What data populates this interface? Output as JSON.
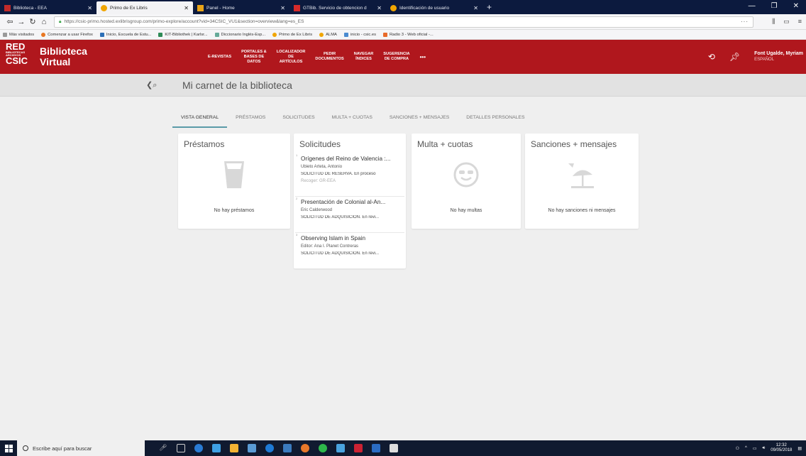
{
  "browser": {
    "tabs": [
      {
        "label": "Biblioteca - EEA",
        "active": false
      },
      {
        "label": "Primo de Ex Libris",
        "active": true
      },
      {
        "label": "Panel - Home",
        "active": false
      },
      {
        "label": "GTBib. Servicio de obtencion d",
        "active": false
      },
      {
        "label": "Identificación de usuario",
        "active": false
      }
    ],
    "url": "https://csic-primo.hosted.exlibrisgroup.com/primo-explore/account?vid=34CSIC_VU1&section=overview&lang=es_ES",
    "bookmarks": [
      "Más visitados",
      "Comenzar a usar Firefox",
      "Inicio, Escuela de Estu...",
      "KIT-Bibliothek | Karlsr...",
      "Diccionario Inglés-Esp...",
      "Primo de Ex Libris",
      "ALMA",
      "inicio - csic.es",
      "Radio 3 - Web oficial -..."
    ]
  },
  "header": {
    "logo_mark": "RED",
    "logo_mark_small": "BIBLIOTECAS ARCHIVOS",
    "logo_mark_bottom": "CSIC",
    "logo_line1": "Biblioteca",
    "logo_line2": "Virtual",
    "nav": [
      {
        "line1": "E-REVISTAS",
        "line2": "",
        "line3": ""
      },
      {
        "line1": "PORTALES &",
        "line2": "BASES DE",
        "line3": "DATOS"
      },
      {
        "line1": "LOCALIZADOR",
        "line2": "DE",
        "line3": "ARTÍCULOS"
      },
      {
        "line1": "PEDIR",
        "line2": "DOCUMENTOS",
        "line3": ""
      },
      {
        "line1": "NAVEGAR",
        "line2": "ÍNDICES",
        "line3": ""
      },
      {
        "line1": "SUGERENCIA",
        "line2": "DE COMPRA",
        "line3": ""
      }
    ],
    "more": "•••",
    "user_name": "Font Ugalde, Myriam",
    "user_lang": "ESPAÑOL"
  },
  "subheader": {
    "title": "Mi carnet de la biblioteca"
  },
  "tabs": [
    {
      "label": "VISTA GENERAL",
      "active": true
    },
    {
      "label": "PRÉSTAMOS",
      "active": false
    },
    {
      "label": "SOLICITUDES",
      "active": false
    },
    {
      "label": "MULTA + CUOTAS",
      "active": false
    },
    {
      "label": "SANCIONES + MENSAJES",
      "active": false
    },
    {
      "label": "DETALLES PERSONALES",
      "active": false
    }
  ],
  "cards": {
    "prestamos": {
      "title": "Préstamos",
      "empty": "No hay préstamos"
    },
    "solicitudes": {
      "title": "Solicitudes",
      "items": [
        {
          "num": "1",
          "title": "Orígenes del Reino de Valencia :...",
          "author": "Ubieto Arteta, Antonio",
          "status": "SOLICITUD DE RESERVA. En proceso",
          "pickup": "Recoger: GR-EEA"
        },
        {
          "num": "2",
          "title": "Presentación de Colonial al-An...",
          "author": "Eric Calderwood",
          "status": "SOLICITUD DE ADQUISICIÓN. En revi...",
          "pickup": ""
        },
        {
          "num": "3",
          "title": "Observing Islam in Spain",
          "author": "Editor: Ana I. Planet Contreras",
          "status": "SOLICITUD DE ADQUISICIÓN. En revi...",
          "pickup": ""
        }
      ]
    },
    "multas": {
      "title": "Multa + cuotas",
      "empty": "No hay multas"
    },
    "sanciones": {
      "title": "Sanciones + mensajes",
      "empty": "No hay sanciones ni mensajes"
    }
  },
  "taskbar": {
    "search_placeholder": "Escribe aquí para buscar",
    "time": "12:32",
    "date": "09/05/2018"
  },
  "colors": {
    "brand": "#b0171d",
    "tab_accent": "#5a9aa8",
    "taskbar": "#101a30"
  }
}
